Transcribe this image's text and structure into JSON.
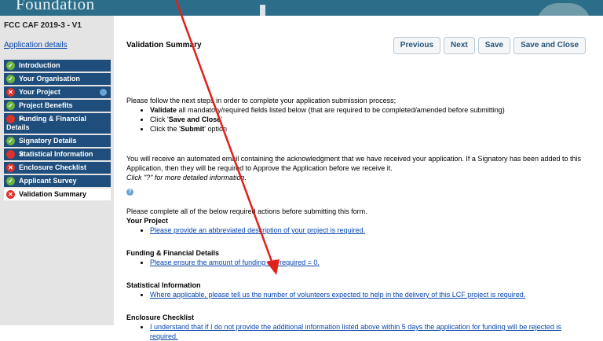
{
  "header": {
    "brand": "Foundation"
  },
  "sidebar": {
    "app_ref": "FCC CAF 2019-3 - V1",
    "app_link": "Application details",
    "items": [
      {
        "label": "Introduction",
        "status": "ok"
      },
      {
        "label": "Your Organisation",
        "status": "ok"
      },
      {
        "label": "Your Project",
        "status": "bad"
      },
      {
        "label": "Project Benefits",
        "status": "ok"
      },
      {
        "label": "Funding & Financial Details",
        "status": "bad"
      },
      {
        "label": "Signatory Details",
        "status": "ok"
      },
      {
        "label": "Statistical Information",
        "status": "bad"
      },
      {
        "label": "Enclosure Checklist",
        "status": "bad"
      },
      {
        "label": "Applicant Survey",
        "status": "ok"
      },
      {
        "label": "Validation Summary",
        "status": "bad"
      }
    ]
  },
  "main": {
    "title": "Validation Summary",
    "buttons": {
      "previous": "Previous",
      "next": "Next",
      "save": "Save",
      "save_close": "Save and Close"
    },
    "intro": "Please follow the next steps in order to complete your application submission process;",
    "steps": {
      "s1a": "Validate",
      "s1b": " all mandatory/required fields listed below (that are required to be completed/amended before submitting)",
      "s2a": "Click '",
      "s2b": "Save and Close",
      "s2c": "'",
      "s3a": "Click the '",
      "s3b": "Submit",
      "s3c": "' option"
    },
    "email_note": "You will receive an automated email containing the acknowledgment that we have received your application. If a Signatory has been added to this Application, then they will be required to Approve the Application before we receive it.",
    "help_note": "Click \"?\" for more detailed information.",
    "help_icon": "?",
    "required_intro": "Please complete all of the below required actions before submitting this form.",
    "sections": [
      {
        "heading": "Your Project",
        "link": "Please provide an abbreviated description of your project is required."
      },
      {
        "heading": "Funding & Financial Details",
        "link": "Please ensure the amount of funding still required = 0."
      },
      {
        "heading": "Statistical Information",
        "link": "Where applicable, please tell us the number of volunteers expected to help in the delivery of this LCF project is required."
      },
      {
        "heading": "Enclosure Checklist",
        "link": "I understand that if I do not provide the additional information listed above within 5 days the application for funding will be rejected is required."
      }
    ]
  },
  "colors": {
    "nav": "#1f4e7c",
    "ok": "#6cb33f",
    "bad": "#d9332b",
    "arrow": "#e0201c"
  }
}
